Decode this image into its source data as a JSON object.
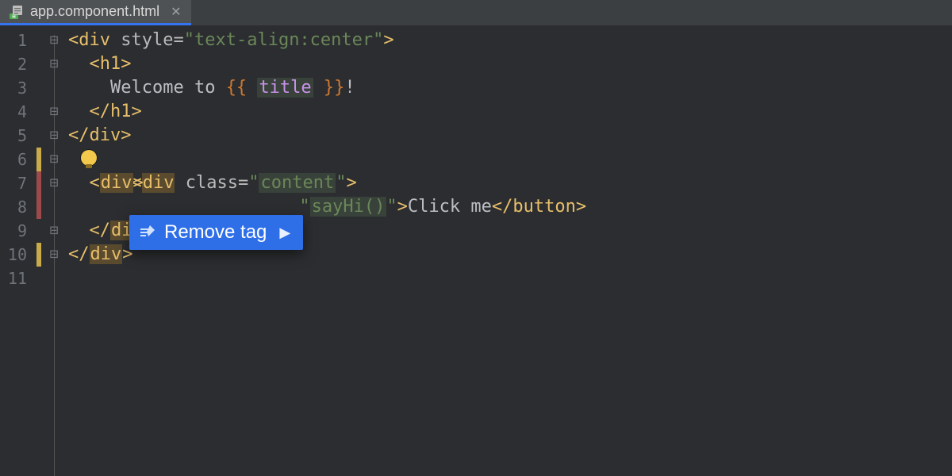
{
  "tab": {
    "filename": "app.component.html"
  },
  "lineNumbers": [
    "1",
    "2",
    "3",
    "4",
    "5",
    "6",
    "7",
    "8",
    "9",
    "10",
    "11"
  ],
  "code": {
    "l1": {
      "open": "<",
      "tag": "div",
      "attr": " style",
      "eq": "=",
      "q1": "\"",
      "val": "text-align:center",
      "q2": "\"",
      "close": ">"
    },
    "l2": {
      "open": "<",
      "tag": "h1",
      "close": ">"
    },
    "l3": {
      "txt1": "Welcome to ",
      "lb": "{{",
      "sp1": " ",
      "var": "title",
      "sp2": " ",
      "rb": "}}",
      "txt2": "!"
    },
    "l4": {
      "open": "</",
      "tag": "h1",
      "close": ">"
    },
    "l5": {
      "open": "</",
      "tag": "div",
      "close": ">"
    },
    "l6": {
      "open": "<",
      "tag": "div",
      "attr": " class",
      "eq": "=",
      "q1": "\"",
      "val": "content",
      "q2": "\"",
      "close": ">"
    },
    "l7": {
      "open": "<",
      "tag": "div",
      "close": ">"
    },
    "l8": {
      "q1": "\"",
      "val": "sayHi()",
      "q2": "\"",
      "gt": ">",
      "txt": "Click me",
      "open2": "</",
      "tag2": "button",
      "close2": ">"
    },
    "l9": {
      "open": "</",
      "tag": "div",
      "close": ">"
    },
    "l10": {
      "open": "</",
      "tag": "div",
      "close": ">"
    }
  },
  "popup": {
    "label": "Remove tag"
  }
}
